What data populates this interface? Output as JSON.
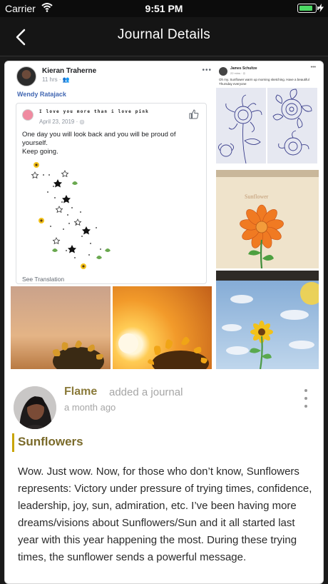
{
  "status_bar": {
    "carrier": "Carrier",
    "time": "9:51 PM"
  },
  "nav": {
    "title": "Journal Details"
  },
  "colors": {
    "accent": "#c8a400",
    "author": "#8a7a3a",
    "link_blue": "#4267b2"
  },
  "collage": {
    "fb_post": {
      "poster": "Kieran Traherne",
      "meta": "11 hrs · ",
      "tagged": "Wendy Ratajack",
      "shared": {
        "name": "I love you more than i love pink",
        "date": "April 23, 2019 · ",
        "text": "One day you will look back and you will be proud of yourself.\nKeep going.",
        "see_translation": "See Translation"
      }
    },
    "fb_post2": {
      "poster": "James Schultze",
      "meta": "22 mins · ",
      "text": "Oh my. Sunflower warm up morning sketching. Have a beautiful Thursday everyone"
    }
  },
  "journal": {
    "author": "Flame",
    "action": "added a journal",
    "time": "a month ago",
    "title": "Sunflowers",
    "body": "Wow. Just wow. Now, for those who don’t know, Sunflowers represents: Victory under pressure of trying times, confidence, leadership, joy, sun, admiration, etc. I’ve been having more dreams/visions about Sunflowers/Sun and it all started last year with this year happening the most. During these trying times, the sunflower sends a powerful message."
  }
}
